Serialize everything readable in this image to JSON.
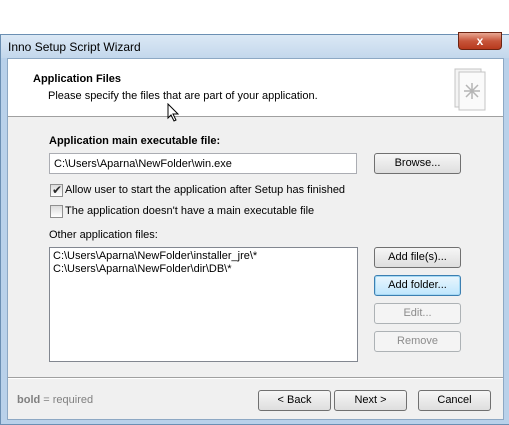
{
  "window": {
    "title": "Inno Setup Script Wizard",
    "close_glyph": "x"
  },
  "header": {
    "title": "Application Files",
    "subtitle": "Please specify the files that are part of your application.",
    "icon": "document-icon"
  },
  "main_exe": {
    "label": "Application main executable file:",
    "value": "C:\\Users\\Aparna\\NewFolder\\win.exe",
    "browse_label": "Browse..."
  },
  "options": [
    {
      "label": "Allow user to start the application after Setup has finished",
      "checked": true
    },
    {
      "label": "The application doesn't have a main executable file",
      "checked": false
    }
  ],
  "other_files": {
    "label": "Other application files:",
    "items": [
      "C:\\Users\\Aparna\\NewFolder\\installer_jre\\*",
      "C:\\Users\\Aparna\\NewFolder\\dir\\DB\\*"
    ],
    "buttons": {
      "add_files": "Add file(s)...",
      "add_folder": "Add folder...",
      "edit": "Edit...",
      "remove": "Remove"
    }
  },
  "footer": {
    "note_bold": "bold",
    "note_rest": " = required",
    "back": "< Back",
    "next": "Next >",
    "cancel": "Cancel"
  }
}
